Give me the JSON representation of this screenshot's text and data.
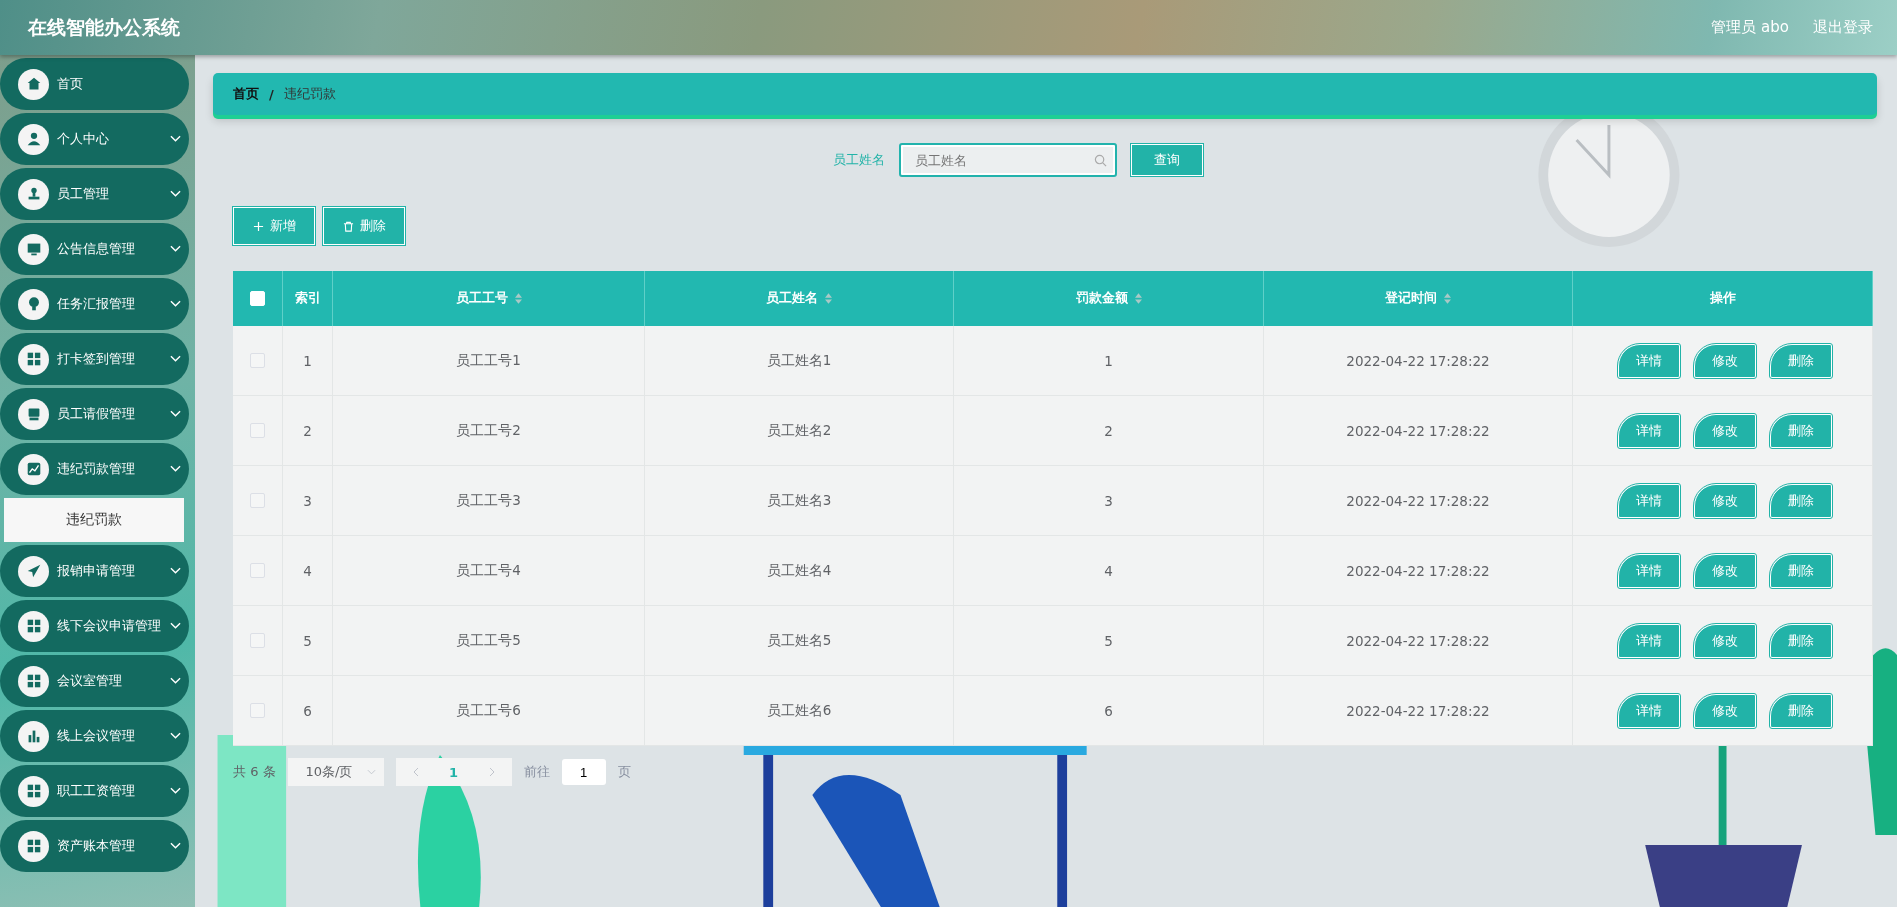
{
  "header": {
    "title": "在线智能办公系统",
    "user": "管理员 abo",
    "logout": "退出登录"
  },
  "sidebar": {
    "items": [
      {
        "label": "首页",
        "kind": "link"
      },
      {
        "label": "个人中心",
        "kind": "submenu"
      },
      {
        "label": "员工管理",
        "kind": "submenu"
      },
      {
        "label": "公告信息管理",
        "kind": "submenu"
      },
      {
        "label": "任务汇报管理",
        "kind": "submenu"
      },
      {
        "label": "打卡签到管理",
        "kind": "submenu"
      },
      {
        "label": "员工请假管理",
        "kind": "submenu"
      },
      {
        "label": "违纪罚款管理",
        "kind": "submenu",
        "children": [
          {
            "label": "违纪罚款",
            "selected": true
          }
        ]
      },
      {
        "label": "报销申请管理",
        "kind": "submenu"
      },
      {
        "label": "线下会议申请管理",
        "kind": "submenu"
      },
      {
        "label": "会议室管理",
        "kind": "submenu"
      },
      {
        "label": "线上会议管理",
        "kind": "submenu"
      },
      {
        "label": "职工工资管理",
        "kind": "submenu"
      },
      {
        "label": "资产账本管理",
        "kind": "submenu"
      }
    ]
  },
  "breadcrumb": {
    "items": [
      "首页",
      "违纪罚款"
    ],
    "separator": "/"
  },
  "search": {
    "label": "员工姓名",
    "placeholder": "员工姓名",
    "button": "查询"
  },
  "actions": [
    {
      "label": "新增",
      "kind": "add"
    },
    {
      "label": "删除",
      "kind": "delete"
    }
  ],
  "table": {
    "all_checked": false,
    "columns": [
      {
        "label": "索引",
        "sortable": false
      },
      {
        "label": "员工工号",
        "sortable": true
      },
      {
        "label": "员工姓名",
        "sortable": true
      },
      {
        "label": "罚款金额",
        "sortable": true
      },
      {
        "label": "登记时间",
        "sortable": true
      },
      {
        "label": "操作",
        "sortable": false
      }
    ],
    "rows": [
      {
        "checked": false,
        "cells": [
          "1",
          "员工工号1",
          "员工姓名1",
          "1",
          "2022-04-22 17:28:22"
        ],
        "buttons": [
          "详情",
          "修改",
          "删除"
        ]
      },
      {
        "checked": false,
        "cells": [
          "2",
          "员工工号2",
          "员工姓名2",
          "2",
          "2022-04-22 17:28:22"
        ],
        "buttons": [
          "详情",
          "修改",
          "删除"
        ]
      },
      {
        "checked": false,
        "cells": [
          "3",
          "员工工号3",
          "员工姓名3",
          "3",
          "2022-04-22 17:28:22"
        ],
        "buttons": [
          "详情",
          "修改",
          "删除"
        ]
      },
      {
        "checked": false,
        "cells": [
          "4",
          "员工工号4",
          "员工姓名4",
          "4",
          "2022-04-22 17:28:22"
        ],
        "buttons": [
          "详情",
          "修改",
          "删除"
        ]
      },
      {
        "checked": false,
        "cells": [
          "5",
          "员工工号5",
          "员工姓名5",
          "5",
          "2022-04-22 17:28:22"
        ],
        "buttons": [
          "详情",
          "修改",
          "删除"
        ]
      },
      {
        "checked": false,
        "cells": [
          "6",
          "员工工号6",
          "员工姓名6",
          "6",
          "2022-04-22 17:28:22"
        ],
        "buttons": [
          "详情",
          "修改",
          "删除"
        ]
      }
    ]
  },
  "pagination": {
    "total": "共 6 条",
    "page_size": "10条/页",
    "pages": [
      {
        "label": "1",
        "selected": true
      }
    ],
    "jump_label": "前往",
    "jump_value": "1",
    "jump_suffix": "页"
  }
}
